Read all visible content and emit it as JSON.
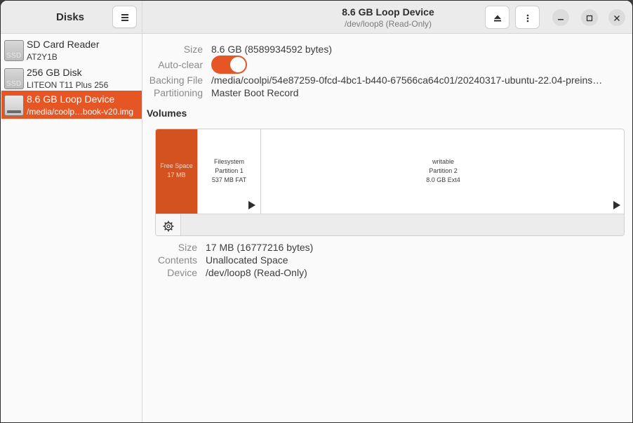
{
  "sidebar": {
    "title": "Disks",
    "menu_icon": "hamburger-icon",
    "items": [
      {
        "name": "SD Card Reader",
        "sub": "AT2Y1B",
        "icon_label": "SSD",
        "selected": false
      },
      {
        "name": "256 GB Disk",
        "sub": "LITEON T11 Plus 256",
        "icon_label": "SSD",
        "selected": false
      },
      {
        "name": "8.6 GB Loop Device",
        "sub": "/media/coolp…book-v20.img",
        "icon_label": "",
        "selected": true
      }
    ]
  },
  "header": {
    "title": "8.6 GB Loop Device",
    "subtitle": "/dev/loop8 (Read-Only)",
    "eject_icon": "eject-icon",
    "more_icon": "more-vertical-icon",
    "minimize_icon": "minimize-icon",
    "maximize_icon": "maximize-icon",
    "close_icon": "close-icon"
  },
  "info": {
    "size_label": "Size",
    "size_value": "8.6 GB (8589934592 bytes)",
    "autoclear_label": "Auto-clear",
    "autoclear_on": true,
    "backing_label": "Backing File",
    "backing_value": "/media/coolpi/54e87259-0fcd-4bc1-b440-67566ca64c01/20240317-ubuntu-22.04-preins…",
    "partitioning_label": "Partitioning",
    "partitioning_value": "Master Boot Record"
  },
  "volumes": {
    "title": "Volumes",
    "items": [
      {
        "line1": "Free Space",
        "line2": "17 MB",
        "line3": "",
        "type": "free"
      },
      {
        "line1": "Filesystem",
        "line2": "Partition 1",
        "line3": "537 MB FAT",
        "type": "partition"
      },
      {
        "line1": "writable",
        "line2": "Partition 2",
        "line3": "8.0 GB Ext4",
        "type": "partition"
      }
    ],
    "settings_icon": "gear-icon"
  },
  "selected_volume": {
    "size_label": "Size",
    "size_value": "17 MB (16777216 bytes)",
    "contents_label": "Contents",
    "contents_value": "Unallocated Space",
    "device_label": "Device",
    "device_value": "/dev/loop8 (Read-Only)"
  },
  "colors": {
    "accent": "#e65524",
    "free_space": "#d4521f"
  }
}
